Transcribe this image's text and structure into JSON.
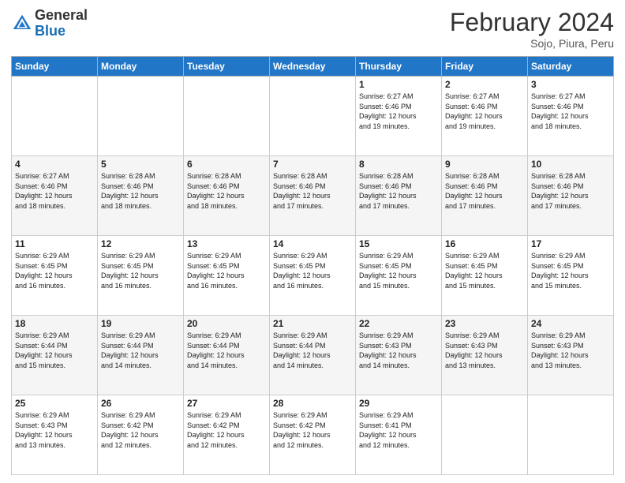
{
  "logo": {
    "general": "General",
    "blue": "Blue"
  },
  "title": "February 2024",
  "subtitle": "Sojo, Piura, Peru",
  "days": [
    "Sunday",
    "Monday",
    "Tuesday",
    "Wednesday",
    "Thursday",
    "Friday",
    "Saturday"
  ],
  "weeks": [
    [
      {
        "day": "",
        "info": ""
      },
      {
        "day": "",
        "info": ""
      },
      {
        "day": "",
        "info": ""
      },
      {
        "day": "",
        "info": ""
      },
      {
        "day": "1",
        "info": "Sunrise: 6:27 AM\nSunset: 6:46 PM\nDaylight: 12 hours\nand 19 minutes."
      },
      {
        "day": "2",
        "info": "Sunrise: 6:27 AM\nSunset: 6:46 PM\nDaylight: 12 hours\nand 19 minutes."
      },
      {
        "day": "3",
        "info": "Sunrise: 6:27 AM\nSunset: 6:46 PM\nDaylight: 12 hours\nand 18 minutes."
      }
    ],
    [
      {
        "day": "4",
        "info": "Sunrise: 6:27 AM\nSunset: 6:46 PM\nDaylight: 12 hours\nand 18 minutes."
      },
      {
        "day": "5",
        "info": "Sunrise: 6:28 AM\nSunset: 6:46 PM\nDaylight: 12 hours\nand 18 minutes."
      },
      {
        "day": "6",
        "info": "Sunrise: 6:28 AM\nSunset: 6:46 PM\nDaylight: 12 hours\nand 18 minutes."
      },
      {
        "day": "7",
        "info": "Sunrise: 6:28 AM\nSunset: 6:46 PM\nDaylight: 12 hours\nand 17 minutes."
      },
      {
        "day": "8",
        "info": "Sunrise: 6:28 AM\nSunset: 6:46 PM\nDaylight: 12 hours\nand 17 minutes."
      },
      {
        "day": "9",
        "info": "Sunrise: 6:28 AM\nSunset: 6:46 PM\nDaylight: 12 hours\nand 17 minutes."
      },
      {
        "day": "10",
        "info": "Sunrise: 6:28 AM\nSunset: 6:46 PM\nDaylight: 12 hours\nand 17 minutes."
      }
    ],
    [
      {
        "day": "11",
        "info": "Sunrise: 6:29 AM\nSunset: 6:45 PM\nDaylight: 12 hours\nand 16 minutes."
      },
      {
        "day": "12",
        "info": "Sunrise: 6:29 AM\nSunset: 6:45 PM\nDaylight: 12 hours\nand 16 minutes."
      },
      {
        "day": "13",
        "info": "Sunrise: 6:29 AM\nSunset: 6:45 PM\nDaylight: 12 hours\nand 16 minutes."
      },
      {
        "day": "14",
        "info": "Sunrise: 6:29 AM\nSunset: 6:45 PM\nDaylight: 12 hours\nand 16 minutes."
      },
      {
        "day": "15",
        "info": "Sunrise: 6:29 AM\nSunset: 6:45 PM\nDaylight: 12 hours\nand 15 minutes."
      },
      {
        "day": "16",
        "info": "Sunrise: 6:29 AM\nSunset: 6:45 PM\nDaylight: 12 hours\nand 15 minutes."
      },
      {
        "day": "17",
        "info": "Sunrise: 6:29 AM\nSunset: 6:45 PM\nDaylight: 12 hours\nand 15 minutes."
      }
    ],
    [
      {
        "day": "18",
        "info": "Sunrise: 6:29 AM\nSunset: 6:44 PM\nDaylight: 12 hours\nand 15 minutes."
      },
      {
        "day": "19",
        "info": "Sunrise: 6:29 AM\nSunset: 6:44 PM\nDaylight: 12 hours\nand 14 minutes."
      },
      {
        "day": "20",
        "info": "Sunrise: 6:29 AM\nSunset: 6:44 PM\nDaylight: 12 hours\nand 14 minutes."
      },
      {
        "day": "21",
        "info": "Sunrise: 6:29 AM\nSunset: 6:44 PM\nDaylight: 12 hours\nand 14 minutes."
      },
      {
        "day": "22",
        "info": "Sunrise: 6:29 AM\nSunset: 6:43 PM\nDaylight: 12 hours\nand 14 minutes."
      },
      {
        "day": "23",
        "info": "Sunrise: 6:29 AM\nSunset: 6:43 PM\nDaylight: 12 hours\nand 13 minutes."
      },
      {
        "day": "24",
        "info": "Sunrise: 6:29 AM\nSunset: 6:43 PM\nDaylight: 12 hours\nand 13 minutes."
      }
    ],
    [
      {
        "day": "25",
        "info": "Sunrise: 6:29 AM\nSunset: 6:43 PM\nDaylight: 12 hours\nand 13 minutes."
      },
      {
        "day": "26",
        "info": "Sunrise: 6:29 AM\nSunset: 6:42 PM\nDaylight: 12 hours\nand 12 minutes."
      },
      {
        "day": "27",
        "info": "Sunrise: 6:29 AM\nSunset: 6:42 PM\nDaylight: 12 hours\nand 12 minutes."
      },
      {
        "day": "28",
        "info": "Sunrise: 6:29 AM\nSunset: 6:42 PM\nDaylight: 12 hours\nand 12 minutes."
      },
      {
        "day": "29",
        "info": "Sunrise: 6:29 AM\nSunset: 6:41 PM\nDaylight: 12 hours\nand 12 minutes."
      },
      {
        "day": "",
        "info": ""
      },
      {
        "day": "",
        "info": ""
      }
    ]
  ]
}
